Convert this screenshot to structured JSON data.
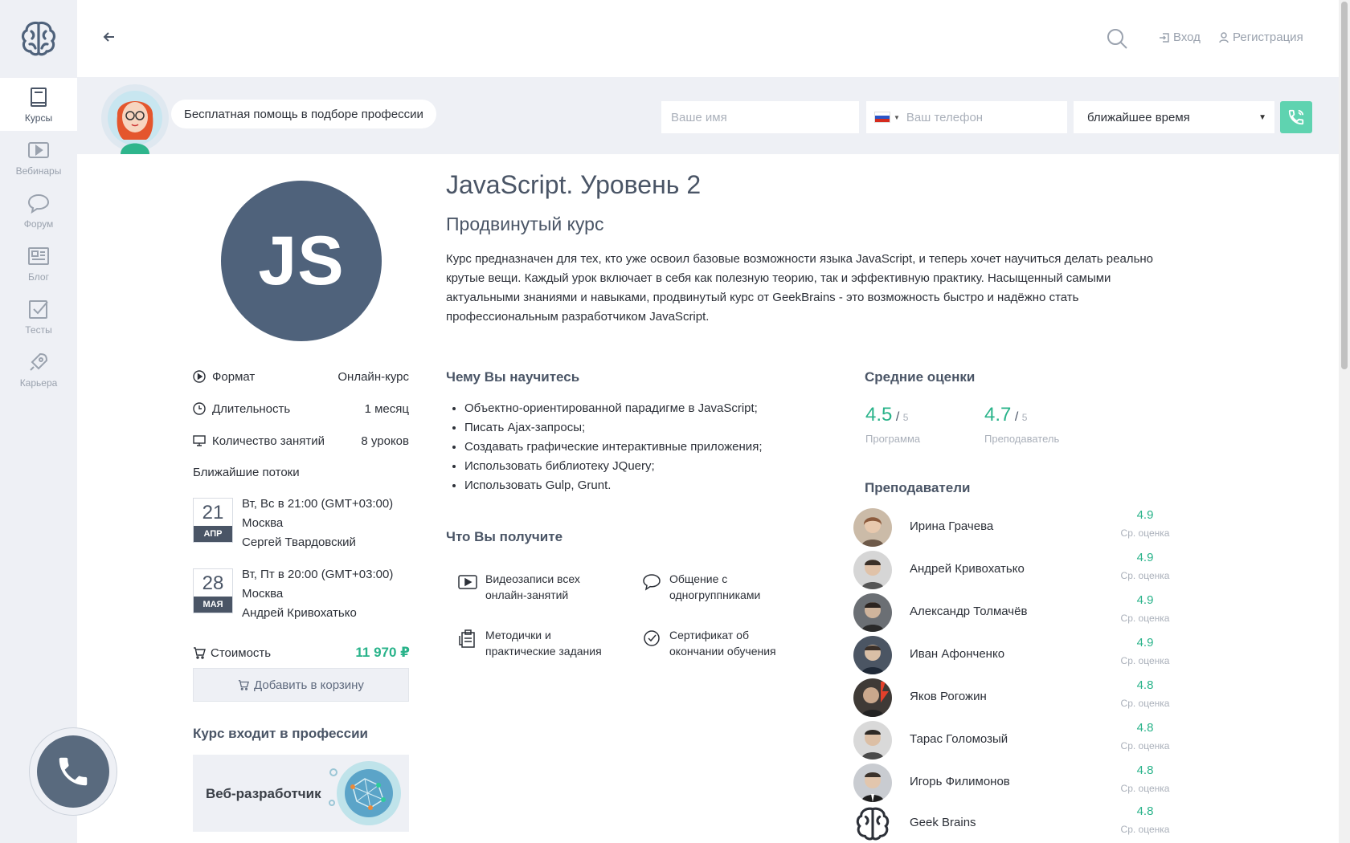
{
  "sidebar": {
    "items": [
      {
        "label": "Курсы",
        "icon": "book-icon",
        "active": true
      },
      {
        "label": "Вебинары",
        "icon": "play-icon"
      },
      {
        "label": "Форум",
        "icon": "chat-icon"
      },
      {
        "label": "Блог",
        "icon": "newspaper-icon"
      },
      {
        "label": "Тесты",
        "icon": "checkbox-icon"
      },
      {
        "label": "Карьера",
        "icon": "rocket-icon"
      }
    ]
  },
  "header": {
    "login": "Вход",
    "register": "Регистрация"
  },
  "help": {
    "bubble": "Бесплатная помощь в подборе профессии",
    "name_placeholder": "Ваше имя",
    "phone_placeholder": "Ваш телефон",
    "time_value": "ближайшее время"
  },
  "course": {
    "logo_text": "JS",
    "title": "JavaScript. Уровень 2",
    "subtitle": "Продвинутый курс",
    "description": "Курс предназначен для тех, кто уже освоил базовые возможности языка JavaScript, и теперь хочет научиться делать реально крутые вещи. Каждый урок включает в себя как полезную теорию, так и эффективную практику. Насыщенный самыми актуальными знаниями и навыками, продвинутый курс от GeekBrains - это возможность быстро и надёжно стать профессиональным разработчиком JavaScript."
  },
  "info": {
    "format_label": "Формат",
    "format_value": "Онлайн-курс",
    "duration_label": "Длительность",
    "duration_value": "1 месяц",
    "lessons_label": "Количество занятий",
    "lessons_value": "8 уроков",
    "streams_title": "Ближайшие потоки",
    "streams": [
      {
        "day": "21",
        "month": "АПР",
        "schedule": "Вт, Вс в 21:00 (GMT+03:00)",
        "city": "Москва",
        "teacher": "Сергей Твардовский"
      },
      {
        "day": "28",
        "month": "МАЯ",
        "schedule": "Вт, Пт в 20:00 (GMT+03:00)",
        "city": "Москва",
        "teacher": "Андрей Кривохатько"
      }
    ],
    "price_label": "Стоимость",
    "price_value": "11 970 ₽",
    "cart_button": "Добавить в корзину",
    "profession_title": "Курс входит в профессии",
    "profession_name": "Веб-разработчик"
  },
  "learn": {
    "title": "Чему Вы научитесь",
    "items": [
      "Объектно-ориентированной парадигме в JavaScript;",
      "Писать Ajax-запросы;",
      "Создавать графические интерактивные приложения;",
      "Использовать библиотеку JQuery;",
      "Использовать Gulp, Grunt."
    ]
  },
  "benefits": {
    "title": "Что Вы получите",
    "items": [
      {
        "line1": "Видеозаписи всех",
        "line2": "онлайн-занятий",
        "icon": "video-icon"
      },
      {
        "line1": "Общение с",
        "line2": "одногруппниками",
        "icon": "speech-bubble-icon"
      },
      {
        "line1": "Методички и",
        "line2": "практические задания",
        "icon": "clipboard-icon"
      },
      {
        "line1": "Сертификат об",
        "line2": "окончании обучения",
        "icon": "check-circle-icon"
      }
    ]
  },
  "ratings": {
    "title": "Средние оценки",
    "items": [
      {
        "value": "4.5",
        "max": "5",
        "label": "Программа"
      },
      {
        "value": "4.7",
        "max": "5",
        "label": "Преподаватель"
      }
    ]
  },
  "teachers": {
    "title": "Преподаватели",
    "score_label": "Ср. оценка",
    "items": [
      {
        "name": "Ирина Грачева",
        "score": "4.9"
      },
      {
        "name": "Андрей Кривохатько",
        "score": "4.9"
      },
      {
        "name": "Александр Толмачёв",
        "score": "4.9"
      },
      {
        "name": "Иван Афонченко",
        "score": "4.9"
      },
      {
        "name": "Яков Рогожин",
        "score": "4.8"
      },
      {
        "name": "Тарас Голомозый",
        "score": "4.8"
      },
      {
        "name": "Игорь Филимонов",
        "score": "4.8"
      },
      {
        "name": "Geek Brains",
        "score": "4.8"
      }
    ]
  },
  "colors": {
    "accent_green": "#29b38a",
    "call_button": "#5fd3b0",
    "course_logo_bg": "#4f627b",
    "sidebar_bg": "#eef0f5"
  }
}
